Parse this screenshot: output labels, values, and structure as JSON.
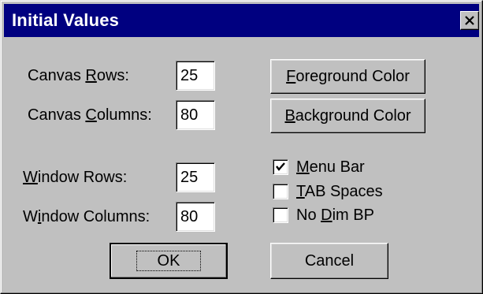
{
  "window": {
    "title": "Initial Values",
    "close_icon": "close-icon"
  },
  "fields": {
    "canvas_rows": {
      "label_pre": "Canvas ",
      "label_key": "R",
      "label_post": "ows:",
      "value": "25"
    },
    "canvas_columns": {
      "label_pre": "Canvas ",
      "label_key": "C",
      "label_post": "olumns:",
      "value": "80"
    },
    "window_rows": {
      "label_pre": "",
      "label_key": "W",
      "label_post": "indow Rows:",
      "value": "25"
    },
    "window_columns": {
      "label_pre": "W",
      "label_key": "i",
      "label_post": "ndow Columns:",
      "value": "80"
    }
  },
  "buttons": {
    "foreground": {
      "key": "F",
      "rest": "oreground Color"
    },
    "background": {
      "key": "B",
      "rest": "ackground Color"
    },
    "ok": "OK",
    "cancel": "Cancel"
  },
  "checkboxes": {
    "menu_bar": {
      "key": "M",
      "rest": "enu Bar",
      "checked": true
    },
    "tab_spaces": {
      "key": "T",
      "rest": "AB Spaces",
      "checked": false
    },
    "no_dim_bp": {
      "pre": "No ",
      "key": "D",
      "rest": "im BP",
      "checked": false
    }
  },
  "colors": {
    "title_bar": "#000080",
    "face": "#c0c0c0"
  }
}
